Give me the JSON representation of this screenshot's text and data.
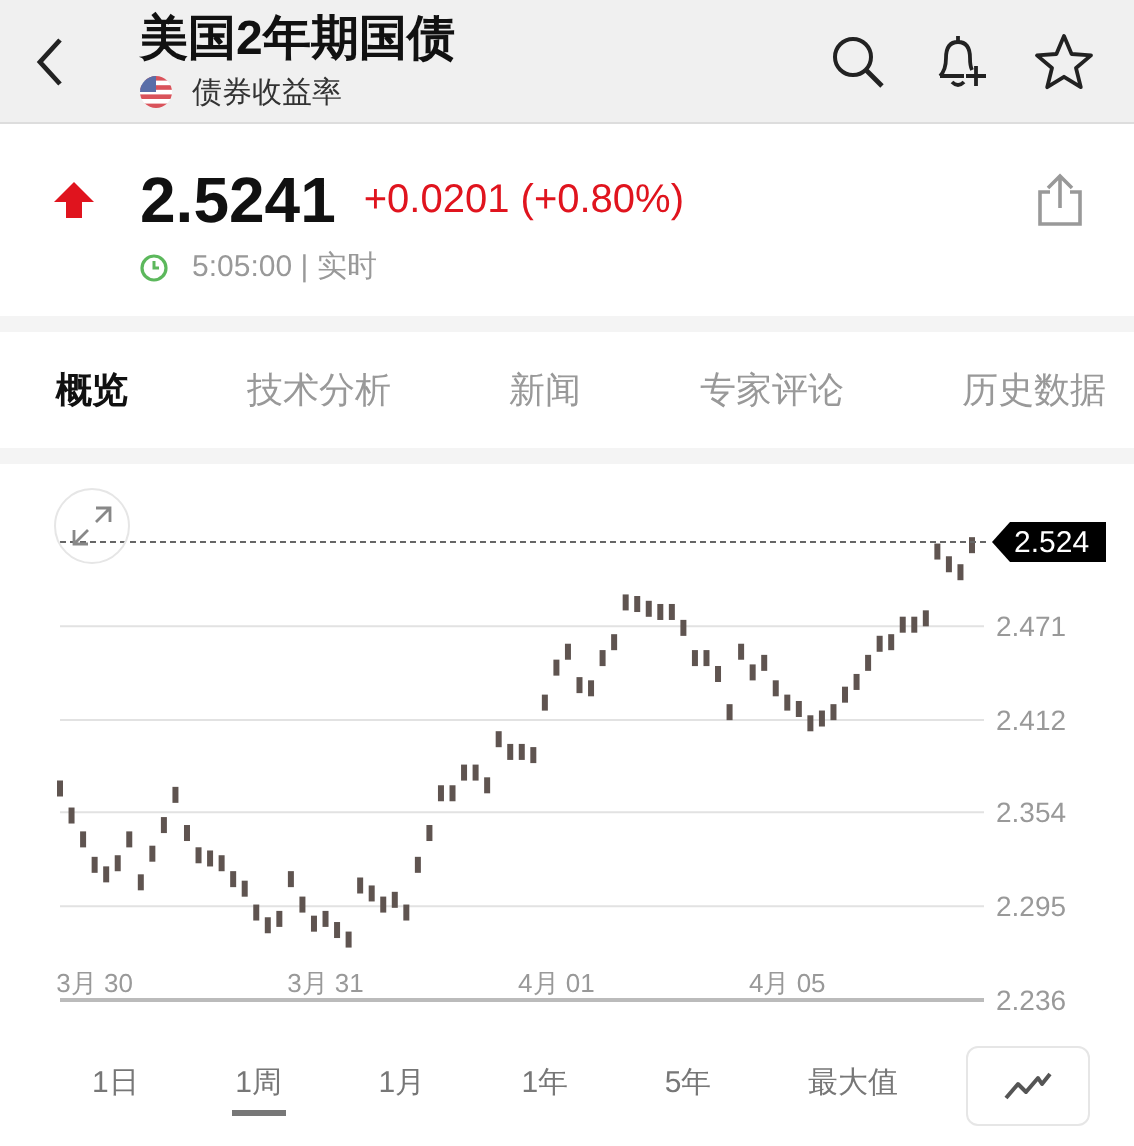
{
  "header": {
    "title": "美国2年期国债",
    "subtitle": "债券收益率"
  },
  "quote": {
    "rising": true,
    "price": "2.5241",
    "change": "+0.0201 (+0.80%)",
    "time": "5:05:00",
    "separator": "|",
    "mode": "实时"
  },
  "tabs": [
    {
      "label": "概览",
      "selected": true
    },
    {
      "label": "技术分析",
      "selected": false
    },
    {
      "label": "新闻",
      "selected": false
    },
    {
      "label": "专家评论",
      "selected": false
    },
    {
      "label": "历史数据",
      "selected": false
    }
  ],
  "chart": {
    "current_tag": "2.524",
    "chart_data": {
      "type": "scatter",
      "ylim": [
        2.236,
        2.524
      ],
      "grid": true,
      "yticks": [
        2.236,
        2.295,
        2.354,
        2.412,
        2.471
      ],
      "categories": [
        null,
        null,
        null,
        "3月 30",
        null,
        null,
        null,
        null,
        null,
        null,
        null,
        null,
        null,
        null,
        null,
        null,
        null,
        null,
        null,
        null,
        null,
        null,
        null,
        "3月 31",
        null,
        null,
        null,
        null,
        null,
        null,
        null,
        null,
        null,
        null,
        null,
        null,
        null,
        null,
        null,
        null,
        null,
        null,
        null,
        "4月 01",
        null,
        null,
        null,
        null,
        null,
        null,
        null,
        null,
        null,
        null,
        null,
        null,
        null,
        null,
        null,
        null,
        null,
        null,
        null,
        "4月 05",
        null,
        null,
        null,
        null,
        null,
        null,
        null,
        null,
        null,
        null,
        null,
        null,
        null,
        null,
        null,
        null
      ],
      "series": [
        {
          "color": "#5f5450",
          "values": [
            2.369,
            2.352,
            2.337,
            2.321,
            2.315,
            2.322,
            2.337,
            2.31,
            2.328,
            2.346,
            2.365,
            2.341,
            2.327,
            2.325,
            2.322,
            2.312,
            2.306,
            2.291,
            2.283,
            2.287,
            2.312,
            2.296,
            2.284,
            2.287,
            2.28,
            2.274,
            2.308,
            2.303,
            2.296,
            2.299,
            2.291,
            2.321,
            2.341,
            2.366,
            2.366,
            2.379,
            2.379,
            2.371,
            2.4,
            2.392,
            2.392,
            2.39,
            2.423,
            2.445,
            2.455,
            2.434,
            2.432,
            2.451,
            2.461,
            2.486,
            2.485,
            2.482,
            2.48,
            2.48,
            2.47,
            2.451,
            2.451,
            2.441,
            2.417,
            2.455,
            2.442,
            2.448,
            2.432,
            2.423,
            2.419,
            2.41,
            2.413,
            2.417,
            2.428,
            2.436,
            2.448,
            2.46,
            2.461,
            2.472,
            2.472,
            2.476,
            2.518,
            2.51,
            2.505,
            2.522
          ]
        }
      ]
    }
  },
  "periods": [
    {
      "label": "1日",
      "selected": false
    },
    {
      "label": "1周",
      "selected": true
    },
    {
      "label": "1月",
      "selected": false
    },
    {
      "label": "1年",
      "selected": false
    },
    {
      "label": "5年",
      "selected": false
    },
    {
      "label": "最大值",
      "selected": false
    }
  ]
}
